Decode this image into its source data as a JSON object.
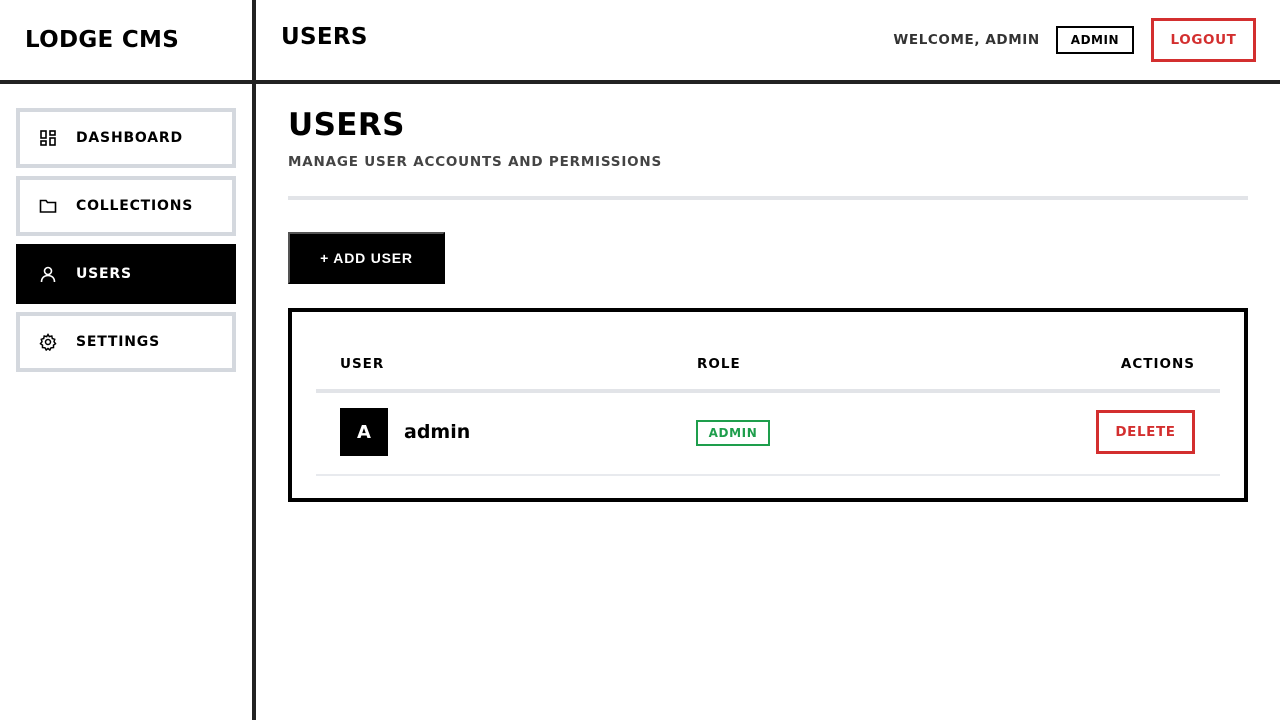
{
  "header": {
    "brand": "LODGE CMS",
    "title": "USERS",
    "welcome": "WELCOME, ADMIN",
    "role_chip": "ADMIN",
    "logout_label": "LOGOUT"
  },
  "sidebar": {
    "items": [
      {
        "label": "DASHBOARD",
        "icon": "dashboard-icon",
        "active": false
      },
      {
        "label": "COLLECTIONS",
        "icon": "folder-icon",
        "active": false
      },
      {
        "label": "USERS",
        "icon": "user-icon",
        "active": true
      },
      {
        "label": "SETTINGS",
        "icon": "gear-icon",
        "active": false
      }
    ]
  },
  "main": {
    "title": "USERS",
    "subtitle": "MANAGE USER ACCOUNTS AND PERMISSIONS",
    "add_button_label": "+ ADD USER",
    "table": {
      "columns": [
        "USER",
        "ROLE",
        "ACTIONS"
      ],
      "rows": [
        {
          "avatar": "A",
          "name": "admin",
          "role": "ADMIN",
          "action_label": "DELETE"
        }
      ]
    }
  },
  "colors": {
    "danger": "#d32f2f",
    "success": "#1e9e4c",
    "border": "#d4d8de",
    "active_bg": "#000000"
  }
}
